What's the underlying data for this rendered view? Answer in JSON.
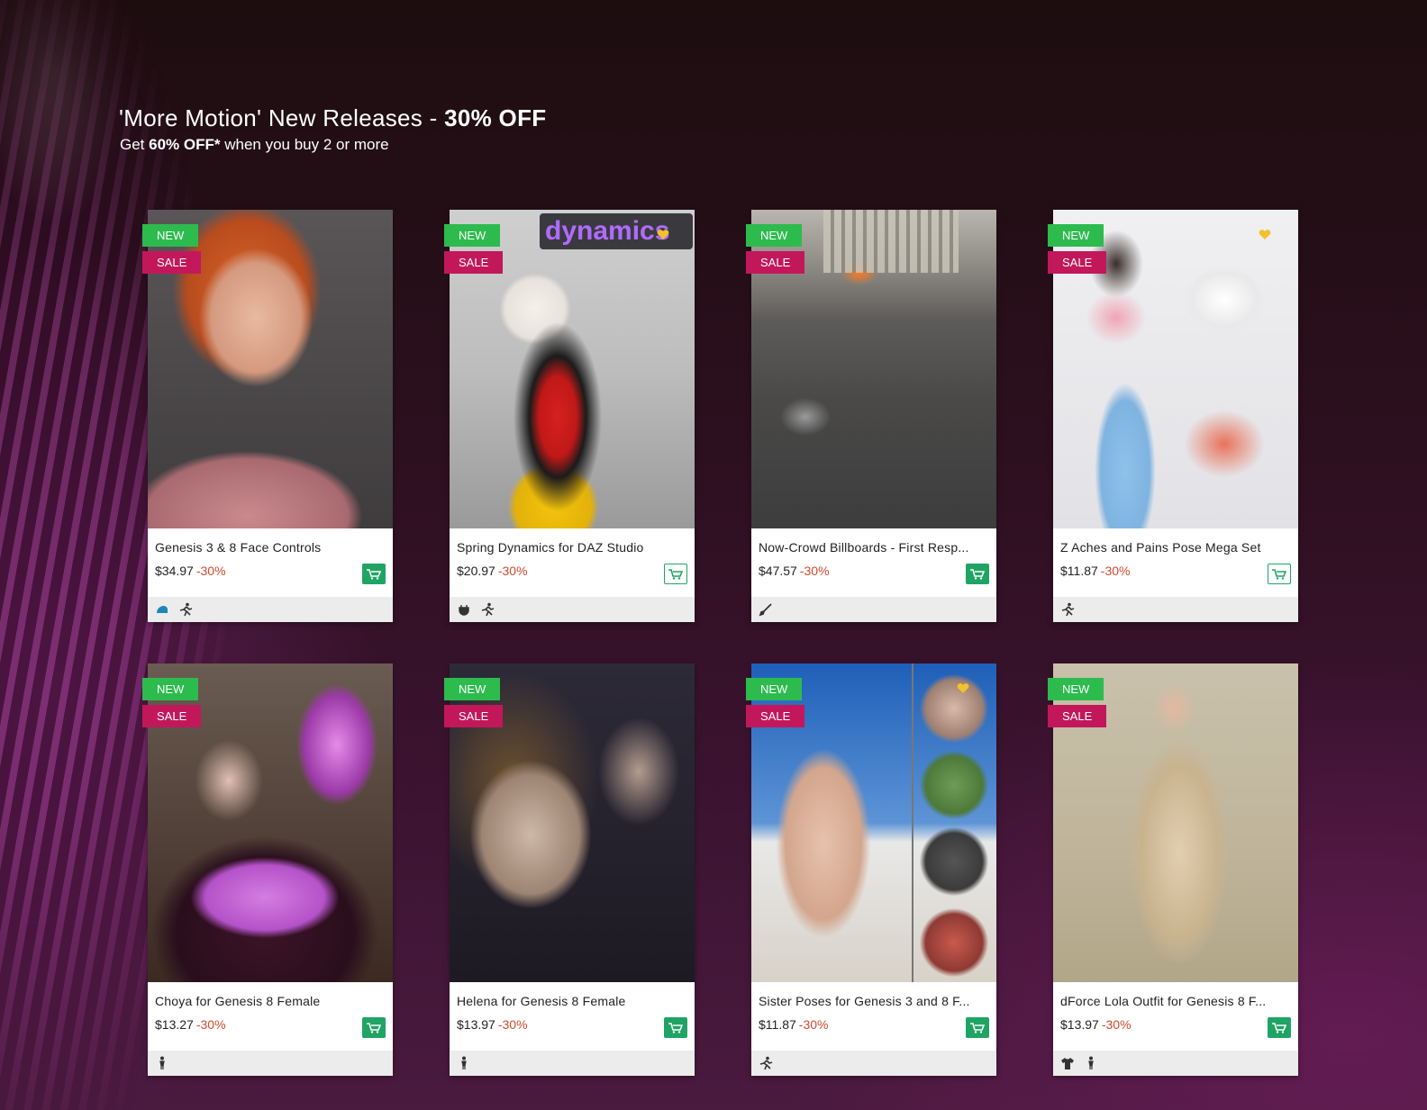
{
  "promo": {
    "title_prefix": "'More Motion' New Releases - ",
    "title_bold": "30% OFF",
    "sub_prefix": "Get ",
    "sub_bold": "60% OFF*",
    "sub_suffix": " when you buy 2 or more"
  },
  "badges": {
    "new": "NEW",
    "sale": "SALE"
  },
  "colors": {
    "new_badge": "#2dbb4e",
    "sale_badge": "#c2185b",
    "discount_text": "#d14a2e",
    "cart_green": "#1fa463"
  },
  "products": [
    {
      "title": "Genesis 3 & 8 Face Controls",
      "price": "$34.97",
      "discount": "-30%",
      "cart": "filled",
      "icons": [
        "morph-icon",
        "pose-icon"
      ]
    },
    {
      "title": "Spring Dynamics for DAZ Studio",
      "price": "$20.97",
      "discount": "-30%",
      "cart": "outline",
      "icons": [
        "plugin-icon",
        "pose-icon"
      ]
    },
    {
      "title": "Now-Crowd Billboards - First Resp...",
      "price": "$47.57",
      "discount": "-30%",
      "cart": "filled",
      "icons": [
        "brush-icon"
      ]
    },
    {
      "title": "Z Aches and Pains Pose Mega Set",
      "price": "$11.87",
      "discount": "-30%",
      "cart": "outline",
      "icons": [
        "pose-icon"
      ]
    },
    {
      "title": "Choya for Genesis 8 Female",
      "price": "$13.27",
      "discount": "-30%",
      "cart": "filled",
      "icons": [
        "figure-icon"
      ]
    },
    {
      "title": "Helena for Genesis 8 Female",
      "price": "$13.97",
      "discount": "-30%",
      "cart": "filled",
      "icons": [
        "figure-icon"
      ]
    },
    {
      "title": "Sister Poses for Genesis 3 and 8 F...",
      "price": "$11.87",
      "discount": "-30%",
      "cart": "filled",
      "icons": [
        "pose-icon"
      ]
    },
    {
      "title": "dForce Lola Outfit for Genesis 8 F...",
      "price": "$13.97",
      "discount": "-30%",
      "cart": "filled",
      "icons": [
        "clothing-icon",
        "figure-icon"
      ]
    }
  ]
}
